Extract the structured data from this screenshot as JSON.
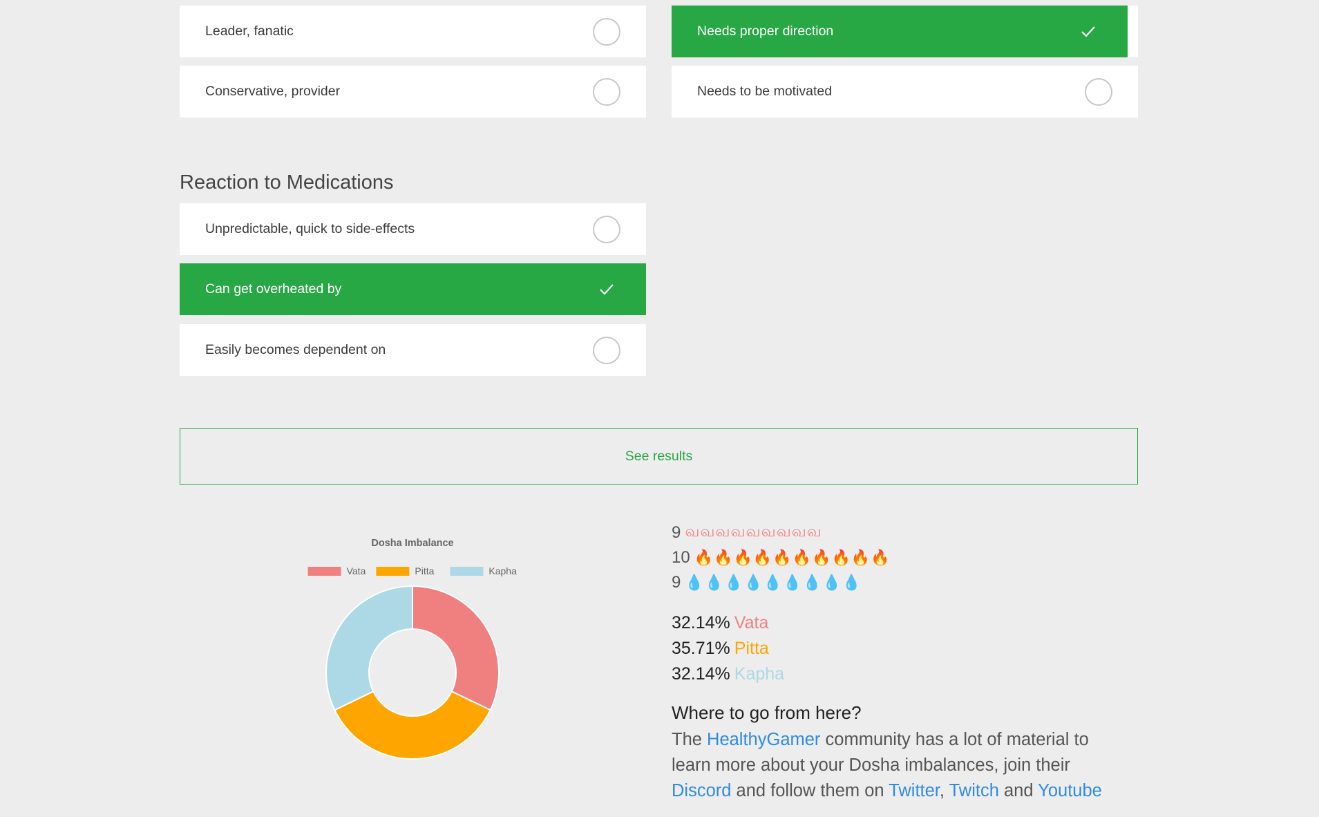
{
  "question_top": {
    "left_options": [
      {
        "label": "Leader, fanatic",
        "selected": false
      },
      {
        "label": "Conservative, provider",
        "selected": false
      }
    ],
    "right_options": [
      {
        "label": "Needs proper direction",
        "selected": true
      },
      {
        "label": "Needs to be motivated",
        "selected": false
      }
    ]
  },
  "medications": {
    "title": "Reaction to Medications",
    "options": [
      {
        "label": "Unpredictable, quick to side-effects",
        "selected": false
      },
      {
        "label": "Can get overheated by",
        "selected": true
      },
      {
        "label": "Easily becomes dependent on",
        "selected": false
      }
    ]
  },
  "results_button": {
    "label": "See results"
  },
  "chart_data": {
    "type": "pie",
    "title": "Dosha Imbalance",
    "categories": [
      "Vata",
      "Pitta",
      "Kapha"
    ],
    "values": [
      9,
      10,
      9
    ],
    "colors": [
      "#f08080",
      "#ffa500",
      "#add8e6"
    ],
    "legend": "top",
    "donut": true
  },
  "tallies": [
    {
      "count": "9",
      "symbol": "வ",
      "icon": "wind-icon",
      "color": "#f08080"
    },
    {
      "count": "10",
      "symbol": "🔥",
      "icon": "fire-icon",
      "color": "#ffa500"
    },
    {
      "count": "9",
      "symbol": "💧",
      "icon": "droplet-icon",
      "color": "#add8e6"
    }
  ],
  "percentages": [
    {
      "value": "32.14%",
      "name": "Vata",
      "color": "#f08080"
    },
    {
      "value": "35.71%",
      "name": "Pitta",
      "color": "#ffa500"
    },
    {
      "value": "32.14%",
      "name": "Kapha",
      "color": "#add8e6"
    }
  ],
  "where": {
    "title": "Where to go from here?",
    "text_1": "The ",
    "link_healthygamer": "HealthyGamer",
    "text_2": " community has a lot of material to learn more about your Dosha imbalances, join their ",
    "link_discord": "Discord",
    "text_3": " and follow them on ",
    "link_twitter": "Twitter",
    "text_4": ", ",
    "link_twitch": "Twitch",
    "text_5": " and ",
    "link_youtube": "Youtube"
  }
}
